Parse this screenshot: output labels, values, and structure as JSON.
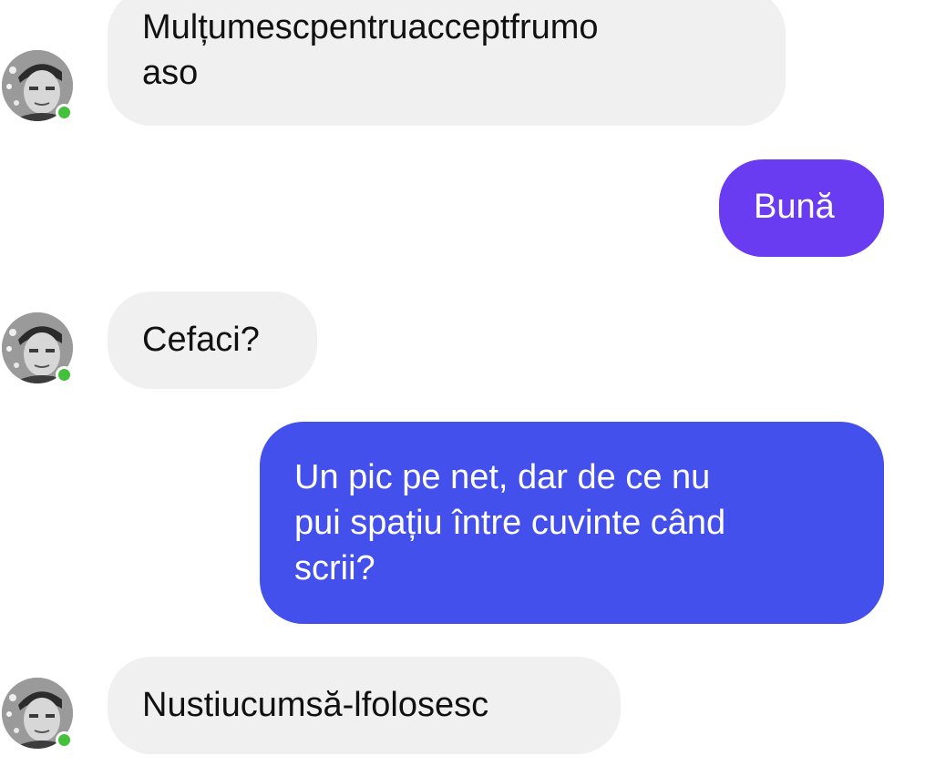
{
  "colors": {
    "incoming_bubble": "#f0f0f0",
    "outgoing_bubble_1": "#6a3cf1",
    "outgoing_bubble_2": "#4450ec",
    "online_indicator": "#44c13b"
  },
  "messages": [
    {
      "from": "contact",
      "lines": [
        "Mulțumescpentruacceptfrumo",
        "aso"
      ]
    },
    {
      "from": "me",
      "lines": [
        "Bună"
      ]
    },
    {
      "from": "contact",
      "lines": [
        "Cefaci?"
      ]
    },
    {
      "from": "me",
      "lines": [
        "Un pic pe net, dar de ce nu",
        "pui spațiu între cuvinte când",
        "scrii?"
      ]
    },
    {
      "from": "contact",
      "lines": [
        "Nustiucumsă-lfolosesc"
      ]
    }
  ]
}
